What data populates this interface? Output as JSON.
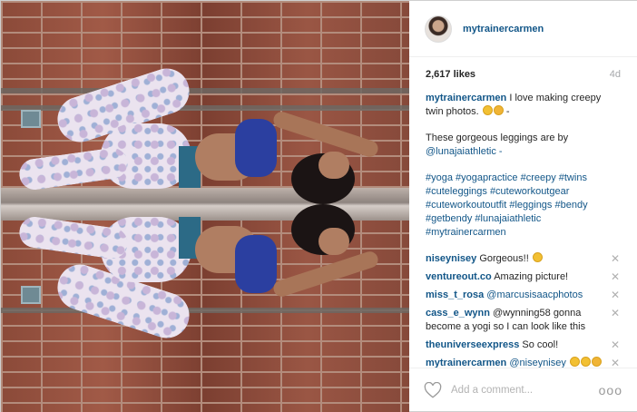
{
  "post": {
    "username": "mytrainercarmen",
    "likes": "2,617 likes",
    "age": "4d"
  },
  "caption": {
    "author": "mytrainercarmen",
    "line1": "I love making creepy twin photos.",
    "emoji_tail": "-",
    "line2": "These gorgeous leggings are by",
    "mention": "@lunajaiathletic -",
    "hashtags": "#yoga #yogapractice #creepy #twins #cuteleggings #cuteworkoutgear #cuteworkoutoutfit #leggings #bendy #getbendy #lunajaiathletic #mytrainercarmen"
  },
  "comments": [
    {
      "user": "niseynisey",
      "text": "Gorgeous!!"
    },
    {
      "user": "ventureout.co",
      "text": "Amazing picture!"
    },
    {
      "user": "miss_t_rosa",
      "text": "@marcusisaacphotos"
    },
    {
      "user": "cass_e_wynn",
      "text": "@wynning58 gonna become a yogi so I can look like this"
    },
    {
      "user": "theuniverseexpress",
      "text": "So cool!"
    },
    {
      "user": "mytrainercarmen",
      "text": "@niseynisey"
    }
  ],
  "footer": {
    "add_comment_placeholder": "Add a comment...",
    "more_label": "ooo"
  },
  "icons": {
    "remove": "close-icon",
    "like": "heart-icon",
    "more": "more-options-icon"
  },
  "colors": {
    "link": "#125688",
    "muted": "#a5a7aa"
  }
}
